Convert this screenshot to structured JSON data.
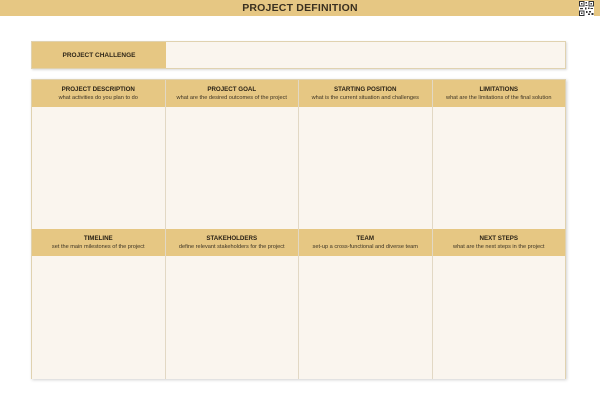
{
  "header": {
    "title": "PROJECT DEFINITION",
    "qr_icon": "qr-code-icon"
  },
  "challenge": {
    "label": "PROJECT CHALLENGE",
    "value": ""
  },
  "sections": [
    {
      "title": "PROJECT DESCRIPTION",
      "subtitle": "what activities do you plan to do"
    },
    {
      "title": "PROJECT GOAL",
      "subtitle": "what are the desired outcomes of the project"
    },
    {
      "title": "STARTING POSITION",
      "subtitle": "what is the current situation and challenges"
    },
    {
      "title": "LIMITATIONS",
      "subtitle": "what are the limitations of the final solution"
    },
    {
      "title": "TIMELINE",
      "subtitle": "set the main milestones of the project"
    },
    {
      "title": "STAKEHOLDERS",
      "subtitle": "define relevant stakeholders for the project"
    },
    {
      "title": "TEAM",
      "subtitle": "set-up a cross-functional and diverse team"
    },
    {
      "title": "NEXT STEPS",
      "subtitle": "what are the next steps in the project"
    }
  ],
  "colors": {
    "accent": "#e6c783",
    "panel": "#faf5ee",
    "text": "#2a2216"
  }
}
